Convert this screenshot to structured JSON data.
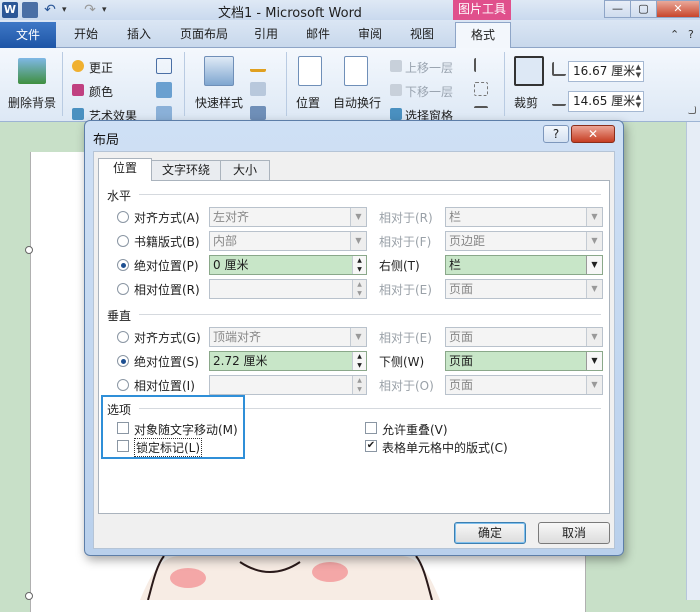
{
  "window": {
    "title": "文档1 - Microsoft Word",
    "context_tab": "图片工具",
    "quick_access": {
      "logo": "W",
      "undo_glyph": "↶",
      "redo_glyph": "↷",
      "dropdown_glyph": "▾"
    },
    "controls": {
      "minimize": "—",
      "maximize": "▢",
      "close": "✕"
    }
  },
  "ribbon_tabs": {
    "file": "文件",
    "items": [
      "开始",
      "插入",
      "页面布局",
      "引用",
      "邮件",
      "审阅",
      "视图"
    ],
    "active": "格式",
    "help_glyph": "?"
  },
  "ribbon": {
    "remove_bg": "删除背景",
    "corrections": "更正",
    "color": "颜色",
    "artistic": "艺术效果",
    "quick_styles": "快速样式",
    "position": "位置",
    "wrap_text": "自动换行",
    "bring_forward": "上移一层",
    "send_backward": "下移一层",
    "selection_pane": "选择窗格",
    "crop": "裁剪",
    "height_value": "16.67 厘米",
    "width_value": "14.65 厘米"
  },
  "dialog": {
    "title": "布局",
    "help": "?",
    "close": "✕",
    "tabs": [
      "位置",
      "文字环绕",
      "大小"
    ],
    "horizontal": {
      "label": "水平",
      "rows": [
        {
          "option": "对齐方式(A)",
          "value": "左对齐",
          "relative_label": "相对于(R)",
          "relative_value": "栏",
          "selected": false
        },
        {
          "option": "书籍版式(B)",
          "value": "内部",
          "relative_label": "相对于(F)",
          "relative_value": "页边距",
          "selected": false
        },
        {
          "option": "绝对位置(P)",
          "value": "0 厘米",
          "relative_label": "右侧(T)",
          "relative_value": "栏",
          "selected": true
        },
        {
          "option": "相对位置(R)",
          "value": "",
          "relative_label": "相对于(E)",
          "relative_value": "页面",
          "selected": false
        }
      ]
    },
    "vertical": {
      "label": "垂直",
      "rows": [
        {
          "option": "对齐方式(G)",
          "value": "顶端对齐",
          "relative_label": "相对于(E)",
          "relative_value": "页面",
          "selected": false
        },
        {
          "option": "绝对位置(S)",
          "value": "2.72 厘米",
          "relative_label": "下侧(W)",
          "relative_value": "页面",
          "selected": true
        },
        {
          "option": "相对位置(I)",
          "value": "",
          "relative_label": "相对于(O)",
          "relative_value": "页面",
          "selected": false
        }
      ]
    },
    "options": {
      "label": "选项",
      "move_with_text": "对象随文字移动(M)",
      "lock_anchor": "锁定标记(L)",
      "allow_overlap": "允许重叠(V)",
      "layout_in_cell": "表格单元格中的版式(C)",
      "move_with_text_checked": false,
      "lock_anchor_checked": false,
      "allow_overlap_checked": false,
      "layout_in_cell_checked": true
    },
    "ok": "确定",
    "cancel": "取消"
  },
  "colors": {
    "accent": "#2f8fd8",
    "context_tab": "#e0508c",
    "field_enabled": "#c8e6c8",
    "doc_bg": "#c8e0c8"
  }
}
